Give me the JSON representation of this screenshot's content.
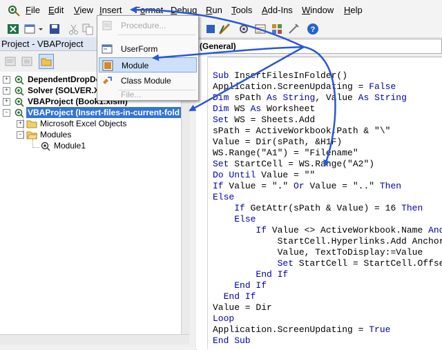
{
  "menubar": {
    "items": [
      {
        "label": "File",
        "u": "F"
      },
      {
        "label": "Edit",
        "u": "E"
      },
      {
        "label": "View",
        "u": "V"
      },
      {
        "label": "Insert",
        "u": "I"
      },
      {
        "label": "Format",
        "u": "o"
      },
      {
        "label": "Debug",
        "u": "D"
      },
      {
        "label": "Run",
        "u": "R"
      },
      {
        "label": "Tools",
        "u": "T"
      },
      {
        "label": "Add-Ins",
        "u": "A"
      },
      {
        "label": "Window",
        "u": "W"
      },
      {
        "label": "Help",
        "u": "H"
      }
    ]
  },
  "insert_menu": {
    "items": [
      {
        "label": "Procedure...",
        "enabled": false,
        "icon": "procedure-icon"
      },
      {
        "label": "UserForm",
        "enabled": true,
        "icon": "userform-icon"
      },
      {
        "label": "Module",
        "enabled": true,
        "highlighted": true,
        "icon": "module-icon"
      },
      {
        "label": "Class Module",
        "enabled": true,
        "icon": "class-module-icon"
      },
      {
        "label": "File...",
        "enabled": false,
        "icon": ""
      }
    ]
  },
  "project_panel": {
    "title": "Project - VBAProject",
    "tree": [
      {
        "label": "DependentDropDo",
        "bold": true,
        "expander": "+"
      },
      {
        "label": "Solver (SOLVER.XL",
        "bold": true,
        "expander": "+"
      },
      {
        "label": "VBAProject (Book1.xlsm)",
        "bold": true,
        "expander": "+"
      },
      {
        "label": "VBAProject (Insert-files-in-current-fold",
        "bold": true,
        "expander": "-",
        "selected": true
      },
      {
        "label": "Microsoft Excel Objects",
        "bold": false,
        "expander": "+"
      },
      {
        "label": "Modules",
        "bold": false,
        "expander": "-"
      },
      {
        "label": "Module1",
        "bold": false,
        "expander": ""
      }
    ]
  },
  "code_pane": {
    "object_combo": "(General)",
    "lines": [
      "Sub InsertFilesInFolder()",
      "Application.ScreenUpdating = False",
      "Dim sPath As String, Value As String",
      "Dim WS As Worksheet",
      "Set WS = Sheets.Add",
      "sPath = ActiveWorkbook.Path & \"\\\"",
      "Value = Dir(sPath, &H1F)",
      "WS.Range(\"A1\") = \"Filename\"",
      "Set StartCell = WS.Range(\"A2\")",
      "Do Until Value = \"\"",
      "If Value = \".\" Or Value = \"..\" Then",
      "Else",
      "    If GetAttr(sPath & Value) = 16 Then",
      "    Else",
      "        If Value <> ActiveWorkbook.Name And",
      "            StartCell.Hyperlinks.Add Anchor",
      "            Value, TextToDisplay:=Value",
      "            Set StartCell = StartCell.Offse",
      "        End If",
      "    End If",
      "  End If",
      "Value = Dir",
      "Loop",
      "Application.ScreenUpdating = True",
      "End Sub"
    ]
  },
  "colors": {
    "keyword": "#0000b0",
    "selection": "#3375d6",
    "arrow": "#2a56d8"
  }
}
